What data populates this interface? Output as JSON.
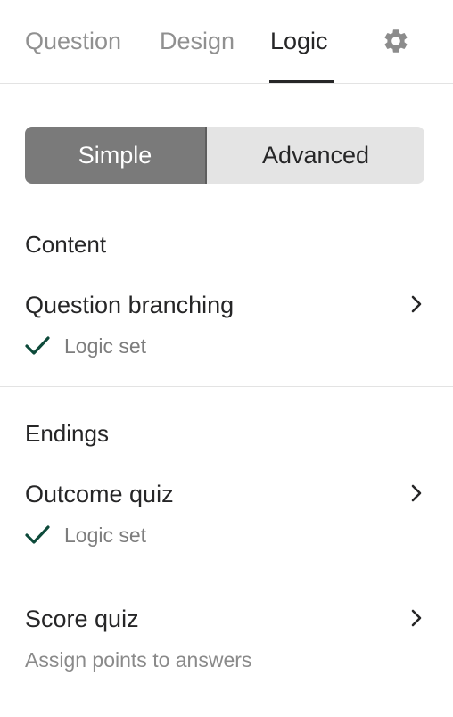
{
  "tabs": {
    "question": "Question",
    "design": "Design",
    "logic": "Logic",
    "active": "Logic",
    "settings_icon": "gear-icon"
  },
  "mode_toggle": {
    "simple": "Simple",
    "advanced": "Advanced",
    "selected": "Simple"
  },
  "content_section": {
    "title": "Content",
    "items": [
      {
        "label": "Question branching",
        "status": "Logic set",
        "status_icon": "checkmark-icon",
        "action_icon": "chevron-right-icon"
      }
    ]
  },
  "endings_section": {
    "title": "Endings",
    "items": [
      {
        "label": "Outcome quiz",
        "status": "Logic set",
        "status_icon": "checkmark-icon",
        "action_icon": "chevron-right-icon"
      },
      {
        "label": "Score quiz",
        "description": "Assign points to answers",
        "action_icon": "chevron-right-icon"
      }
    ]
  },
  "colors": {
    "text_primary": "#262627",
    "text_muted": "#909090",
    "check_green": "#0d4a3a",
    "toggle_selected_bg": "#7a7a7a",
    "toggle_bg": "#e4e4e4"
  }
}
